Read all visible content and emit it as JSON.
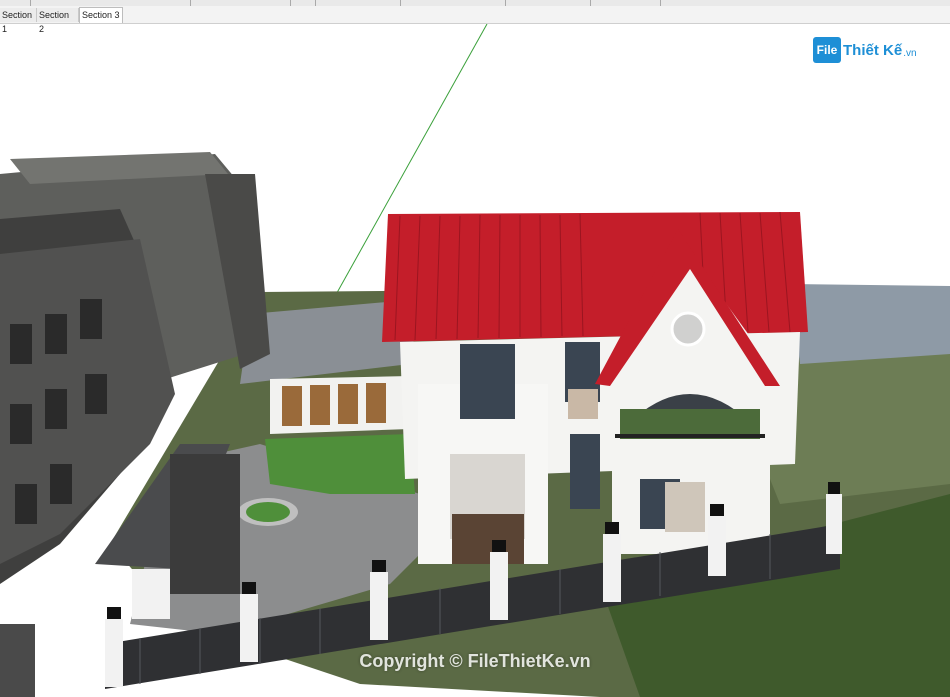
{
  "tabs": [
    {
      "label": "Section 1",
      "active": false
    },
    {
      "label": "Section 2",
      "active": false
    },
    {
      "label": "Section 3",
      "active": true
    }
  ],
  "watermark": {
    "logo_badge": "File",
    "logo_name": "Thiết Kế",
    "logo_tld": ".vn",
    "copyright": "Copyright © FileThietKe.vn"
  },
  "colors": {
    "roof": "#c41e2a",
    "wall": "#f4f4f2",
    "lawn": "#4f8f3a",
    "brand": "#1e8fd6"
  }
}
